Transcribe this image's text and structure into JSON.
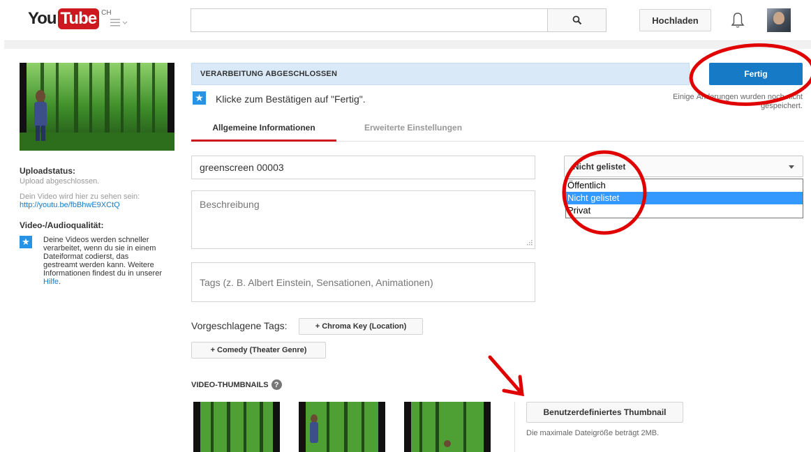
{
  "masthead": {
    "logo_you": "You",
    "logo_tube": "Tube",
    "country": "CH",
    "search_placeholder": "",
    "upload_label": "Hochladen"
  },
  "sidebar": {
    "upload_status_heading": "Uploadstatus:",
    "upload_status_value": "Upload abgeschlossen.",
    "video_link_intro": "Dein Video wird hier zu sehen sein:",
    "video_link": "http://youtu.be/fbBhwE9XCtQ",
    "quality_heading": "Video-/Audioqualität:",
    "quality_text": "Deine Videos werden schneller verarbeitet, wenn du sie in einem Dateiformat codierst, das gestreamt werden kann. Weitere Informationen findest du in unserer ",
    "quality_link": "Hilfe",
    "quality_end": "."
  },
  "status": {
    "processing": "VERARBEITUNG ABGESCHLOSSEN",
    "done_label": "Fertig",
    "hint": "Klicke zum Bestätigen auf \"Fertig\".",
    "unsaved_line1": "Einige Änderungen wurden noch nicht",
    "unsaved_line2": "gespeichert."
  },
  "tabs": [
    {
      "label": "Allgemeine Informationen",
      "active": true
    },
    {
      "label": "Erweiterte Einstellungen",
      "active": false
    }
  ],
  "form": {
    "title_value": "greenscreen 00003",
    "description_placeholder": "Beschreibung",
    "tags_placeholder": "Tags (z. B. Albert Einstein, Sensationen, Animationen)",
    "suggested_label": "Vorgeschlagene Tags:",
    "suggested_tags": [
      "+ Chroma Key (Location)",
      "+ Comedy (Theater Genre)"
    ]
  },
  "privacy": {
    "selected": "Nicht gelistet",
    "options": [
      "Öffentlich",
      "Nicht gelistet",
      "Privat"
    ],
    "highlighted_index": 1
  },
  "thumbnails": {
    "heading": "VIDEO-THUMBNAILS",
    "help_glyph": "?",
    "custom_button": "Benutzerdefiniertes Thumbnail",
    "size_note": "Die maximale Dateigröße beträgt 2MB."
  },
  "colors": {
    "accent_blue": "#167ac6",
    "youtube_red": "#cc181e",
    "annotation_red": "#e00000",
    "status_bg": "#d9e9f7"
  },
  "icons": {
    "search": "search-icon",
    "bell": "bell-icon",
    "guide": "guide-menu-icon",
    "star": "star-icon",
    "help": "help-icon"
  }
}
